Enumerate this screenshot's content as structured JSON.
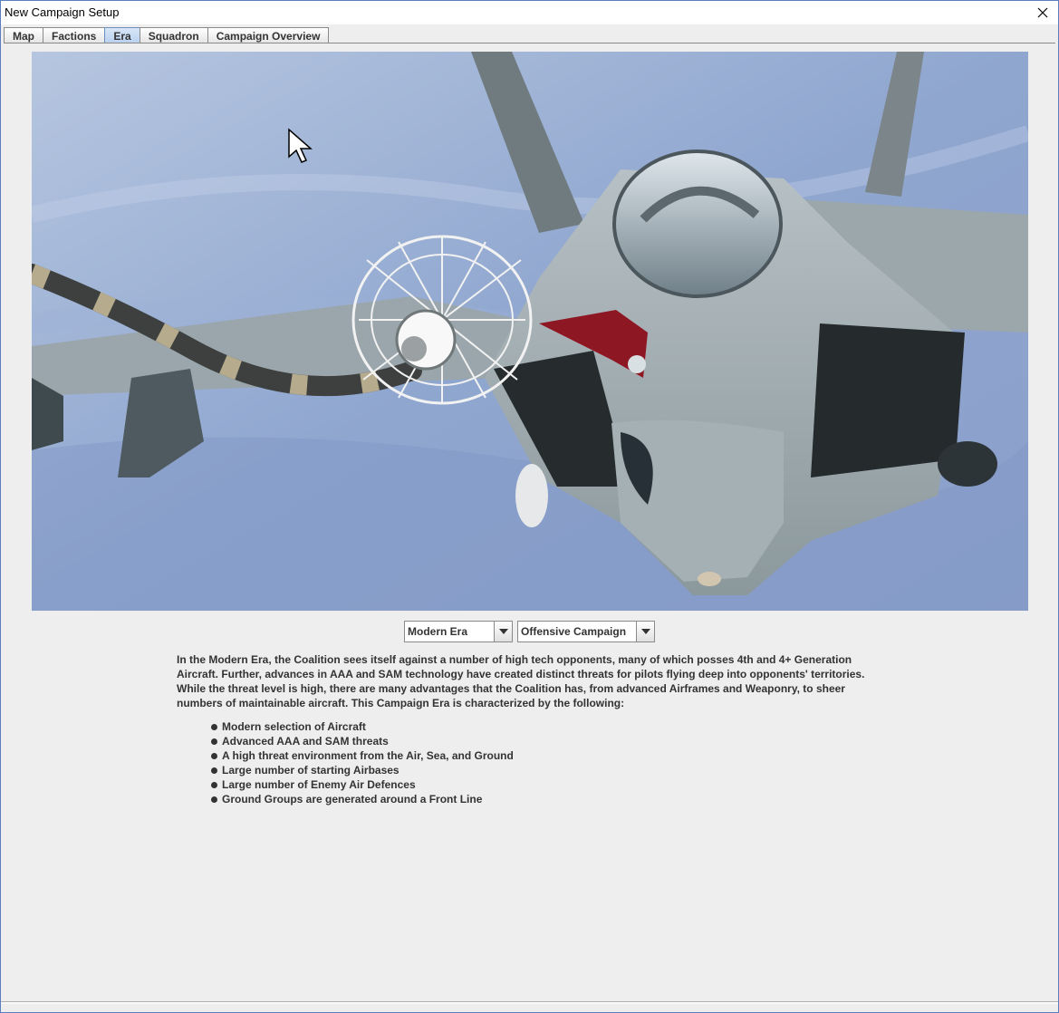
{
  "window": {
    "title": "New Campaign Setup"
  },
  "tabs": [
    {
      "label": "Map",
      "active": false
    },
    {
      "label": "Factions",
      "active": false
    },
    {
      "label": "Era",
      "active": true
    },
    {
      "label": "Squadron",
      "active": false
    },
    {
      "label": "Campaign Overview",
      "active": false
    }
  ],
  "era_selector": {
    "selected": "Modern Era"
  },
  "campaign_type_selector": {
    "selected": "Offensive Campaign"
  },
  "description": "In the Modern Era, the Coalition sees itself against a number of high tech opponents, many of which posses 4th and 4+ Generation Aircraft. Further, advances in AAA and SAM technology have created distinct threats for pilots flying deep into opponents' territories. While the threat level is high, there are many advantages that the Coalition has, from advanced Airframes and Weaponry, to sheer numbers of maintainable aircraft. This Campaign Era is characterized by the following:",
  "features": [
    "Modern selection of Aircraft",
    "Advanced AAA and SAM threats",
    "A high threat environment from the Air, Sea, and Ground",
    "Large number of starting Airbases",
    "Large number of Enemy Air Defences",
    "Ground Groups are generated around a Front Line"
  ],
  "icons": {
    "close": "close-icon",
    "dropdown": "chevron-down-icon",
    "bullet": "bullet-icon",
    "cursor": "mouse-pointer-icon"
  },
  "colors": {
    "background": "#eeeeee",
    "text": "#333333",
    "active_tab": "#b8d0ee",
    "window_border": "#5a7fbf"
  }
}
